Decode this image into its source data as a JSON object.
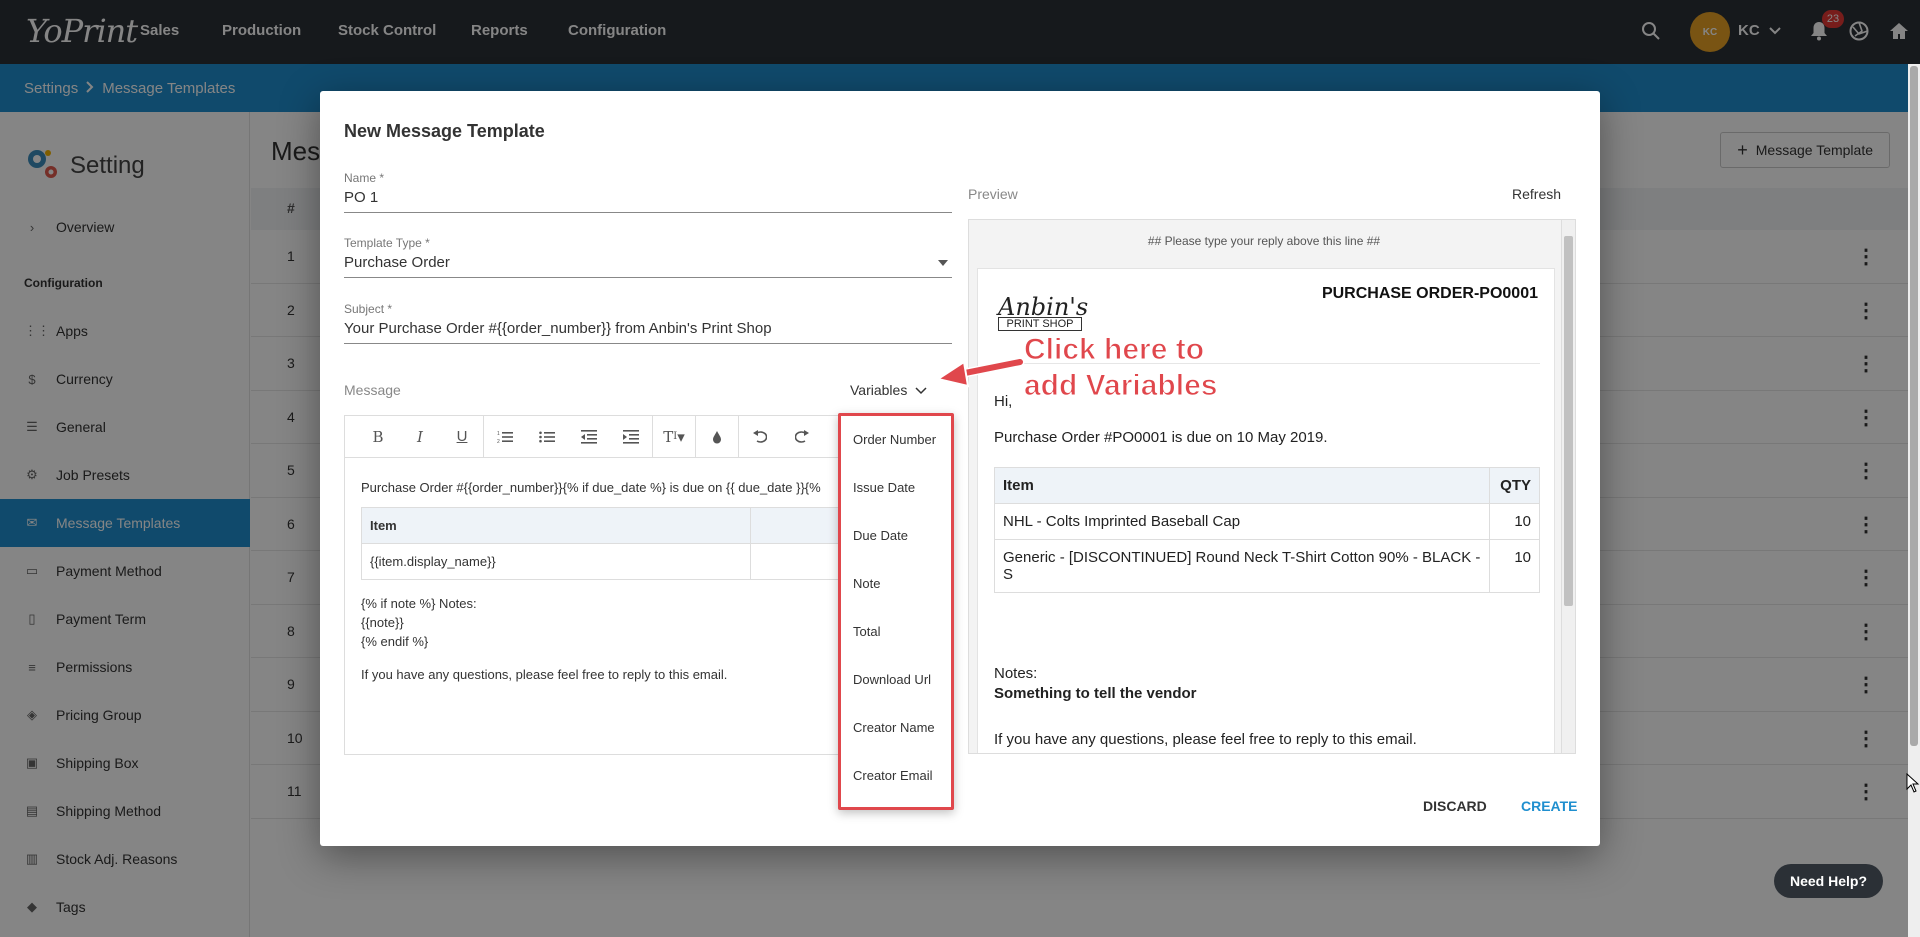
{
  "nav": {
    "logo": "YoPrint",
    "items": [
      "Sales",
      "Production",
      "Stock Control",
      "Reports",
      "Configuration"
    ],
    "user_initials": "KC",
    "user_name": "KC",
    "notification_count": "23"
  },
  "breadcrumb": {
    "parent": "Settings",
    "current": "Message Templates"
  },
  "sidebar": {
    "title": "Setting",
    "overview": "Overview",
    "section": "Configuration",
    "items": [
      {
        "label": "Apps",
        "icon": "grid-icon"
      },
      {
        "label": "Currency",
        "icon": "dollar-icon"
      },
      {
        "label": "General",
        "icon": "sliders-icon"
      },
      {
        "label": "Job Presets",
        "icon": "gear-icon"
      },
      {
        "label": "Message Templates",
        "icon": "mail-icon",
        "active": true
      },
      {
        "label": "Payment Method",
        "icon": "credit-card-icon"
      },
      {
        "label": "Payment Term",
        "icon": "clipboard-icon"
      },
      {
        "label": "Permissions",
        "icon": "list-icon"
      },
      {
        "label": "Pricing Group",
        "icon": "tag-icon"
      },
      {
        "label": "Shipping Box",
        "icon": "box-icon"
      },
      {
        "label": "Shipping Method",
        "icon": "truck-icon"
      },
      {
        "label": "Stock Adj. Reasons",
        "icon": "doc-icon"
      },
      {
        "label": "Tags",
        "icon": "label-icon"
      }
    ]
  },
  "main": {
    "title": "Mess",
    "add_button": "Message Template",
    "table_header": "#",
    "rows": [
      "1",
      "2",
      "3",
      "4",
      "5",
      "6",
      "7",
      "8",
      "9",
      "10",
      "11"
    ]
  },
  "modal": {
    "title": "New Message Template",
    "name": {
      "label": "Name *",
      "value": "PO 1"
    },
    "template_type": {
      "label": "Template Type *",
      "value": "Purchase Order"
    },
    "subject": {
      "label": "Subject *",
      "value": "Your Purchase Order #{{order_number}} from Anbin's Print Shop"
    },
    "message_label": "Message",
    "variables_label": "Variables",
    "editor": {
      "line1": "Purchase Order #{{order_number}}{% if due_date %} is due on {{ due_date }}{%",
      "table_head_item": "Item",
      "table_cell_item": "{{item.display_name}}",
      "table_cell_qty": "{{",
      "notes1": "{% if note %} Notes:",
      "notes2": "{{note}}",
      "notes3": "{% endif %}",
      "footer": "If you have any questions, please feel free to reply to this email."
    },
    "variables": [
      "Order Number",
      "Issue Date",
      "Due Date",
      "Note",
      "Total",
      "Download Url",
      "Creator Name",
      "Creator Email"
    ],
    "preview": {
      "label": "Preview",
      "refresh": "Refresh",
      "hint": "## Please type your reply above this line ##",
      "logo_script": "Anbin's",
      "logo_box": "PRINT SHOP",
      "po_title": "PURCHASE ORDER-PO0001",
      "greeting": "Hi,",
      "due_line": "Purchase Order #PO0001 is due on 10 May 2019.",
      "table_headers": [
        "Item",
        "QTY"
      ],
      "table_rows": [
        {
          "item": "NHL - Colts Imprinted Baseball Cap",
          "qty": "10"
        },
        {
          "item": "Generic - [DISCONTINUED] Round Neck T-Shirt Cotton 90% - BLACK - S",
          "qty": "10"
        }
      ],
      "notes_label": "Notes:",
      "notes_value": "Something to tell the vendor",
      "footer": "If you have any questions, please feel free to reply to this email."
    },
    "discard": "DISCARD",
    "create": "CREATE"
  },
  "annotation": {
    "line1": "Click here to",
    "line2": "add Variables",
    "color": "#e0474c"
  },
  "need_help": "Need Help?",
  "colors": {
    "nav_bg": "#2b3036",
    "accent": "#1f8fcf",
    "avatar": "#e8a225",
    "badge": "#e53935"
  }
}
